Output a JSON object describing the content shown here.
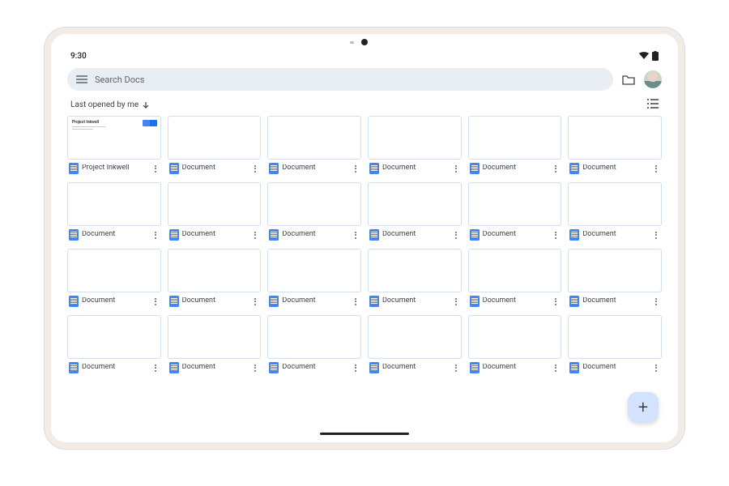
{
  "status": {
    "time": "9:30"
  },
  "search": {
    "placeholder": "Search Docs"
  },
  "sort": {
    "label": "Last opened by me"
  },
  "fab": {
    "label": "+"
  },
  "docs": [
    {
      "title": "Project Inkwell",
      "special": true
    },
    {
      "title": "Document"
    },
    {
      "title": "Document"
    },
    {
      "title": "Document"
    },
    {
      "title": "Document"
    },
    {
      "title": "Document"
    },
    {
      "title": "Document"
    },
    {
      "title": "Document"
    },
    {
      "title": "Document"
    },
    {
      "title": "Document"
    },
    {
      "title": "Document"
    },
    {
      "title": "Document"
    },
    {
      "title": "Document"
    },
    {
      "title": "Document"
    },
    {
      "title": "Document"
    },
    {
      "title": "Document"
    },
    {
      "title": "Document"
    },
    {
      "title": "Document"
    },
    {
      "title": "Document"
    },
    {
      "title": "Document"
    },
    {
      "title": "Document"
    },
    {
      "title": "Document"
    },
    {
      "title": "Document"
    },
    {
      "title": "Document"
    }
  ],
  "project_thumb": {
    "title": "Project Inkwell"
  }
}
